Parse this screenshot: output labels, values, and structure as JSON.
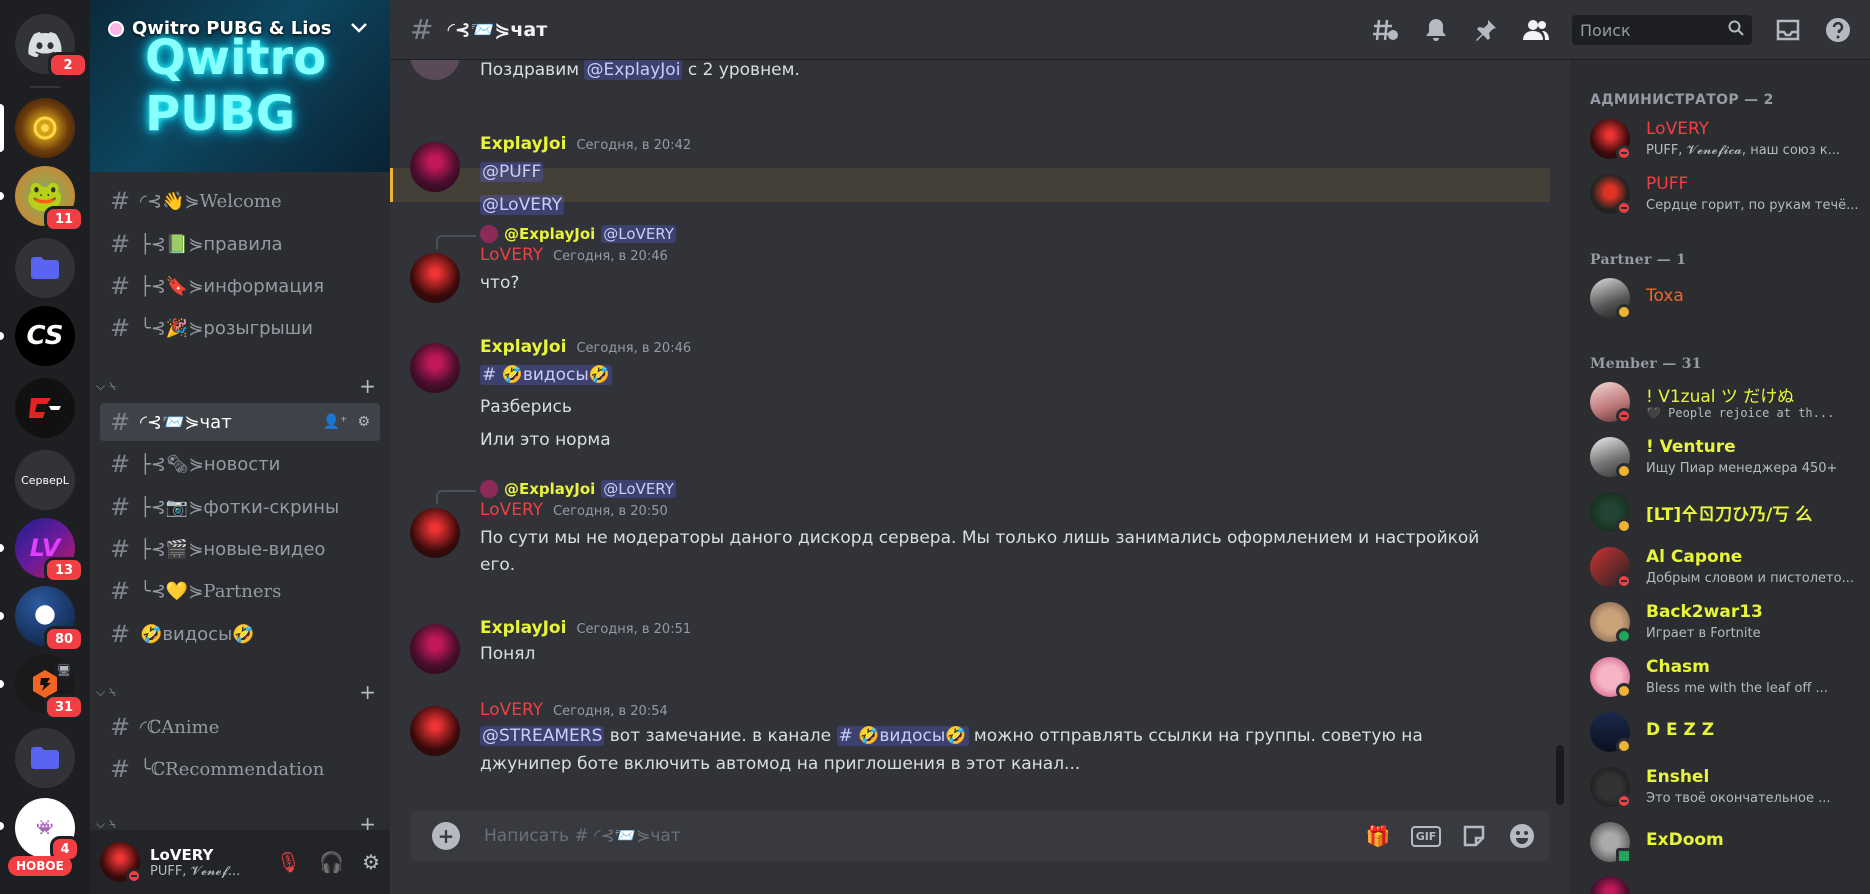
{
  "rail": {
    "badges": [
      "2",
      "11",
      "13",
      "80",
      "31",
      "4"
    ],
    "server_text": "СервepL",
    "new_label": "НОВОЕ"
  },
  "server": {
    "name": "Qwitro PUBG & Lios",
    "banner_text": "Qwitro PUBG"
  },
  "channels": [
    {
      "label": "◜⊰👋⋟Welcome"
    },
    {
      "label": "├⊰📗⋟правила"
    },
    {
      "label": "├⊰🔖⋟информация"
    },
    {
      "label": "╰⊰🎉⋟розыгрыши"
    },
    {
      "label": "◜⊰📨⋟чат"
    },
    {
      "label": "├⊰🗞⋟новости"
    },
    {
      "label": "├⊰📷⋟фотки-скрины"
    },
    {
      "label": "├⊰🎬⋟новые-видео"
    },
    {
      "label": "╰⊰💛⋟Partners"
    },
    {
      "label": "🤣видосы🤣"
    },
    {
      "label": "◜ℂAnime"
    },
    {
      "label": "╰ℂRecommendation"
    }
  ],
  "categories": [
    "⌵ ⍀",
    "⌵ ⍀",
    "⌵ ⍀"
  ],
  "user": {
    "name": "LoVERY",
    "status": "PUFF, 𝓥𝓮𝓷𝓮𝓯..."
  },
  "header": {
    "channel": "◜⊰📨⋟чат",
    "search_placeholder": "Поиск"
  },
  "messages": {
    "m0": {
      "text_a": "Поздравим ",
      "mention": "@ExplayJoi",
      "text_b": " с 2 уровнем."
    },
    "m1": {
      "author": "ExplayJoi",
      "time": "Сегодня, в 20:42",
      "line1": "@PUFF",
      "line2": "@LoVERY"
    },
    "m2": {
      "reply_author": "@ExplayJoi",
      "reply_text": "@LoVERY",
      "author": "LoVERY",
      "time": "Сегодня, в 20:46",
      "text": "что?"
    },
    "m3": {
      "author": "ExplayJoi",
      "time": "Сегодня, в 20:46",
      "channel_mention": "# 🤣видосы🤣",
      "line2": "Разберись",
      "line3": "Или это норма"
    },
    "m4": {
      "reply_author": "@ExplayJoi",
      "reply_text": "@LoVERY",
      "author": "LoVERY",
      "time": "Сегодня, в 20:50",
      "line1": "По сути мы не модераторы даного дискорд сервера. Мы только лишь занимались оформлением и настройкой",
      "line2": "его."
    },
    "m5": {
      "author": "ExplayJoi",
      "time": "Сегодня, в 20:51",
      "text": "Понял"
    },
    "m6": {
      "author": "LoVERY",
      "time": "Сегодня, в 20:54",
      "mention": "@STREAMERS",
      "text_a": " вот замечание. в канале ",
      "channel_mention": "# 🤣видосы🤣",
      "text_b": " можно отправлять ссылки на группы. советую на",
      "line2": "джунипер боте включить автомод на приглошения в этот канал..."
    }
  },
  "composer": {
    "placeholder": "Написать # ◜⊰📨⋟чат",
    "gif_label": "GIF"
  },
  "members": {
    "groups": [
      "АДМИНИСТРАТОР — 2",
      "Partner — 1",
      "Member — 31"
    ],
    "list": [
      {
        "name": "LoVERY",
        "status": "PUFF, 𝓥𝓮𝓷𝓮𝓯𝓲𝓬𝓪, наш союз к...",
        "color": "#f23f43"
      },
      {
        "name": "PUFF",
        "status": "Сердце горит, по рукам течё...",
        "color": "#f23f43"
      },
      {
        "name": "Toxa",
        "status": "",
        "color": "#f26522"
      },
      {
        "name": "! V1zual ツ だけぬ",
        "status": "🖤 People rejoice at th...",
        "color": "#e8f53b"
      },
      {
        "name": "! Venture",
        "status": "Ищу Пиар менеджера 450+",
        "color": "#e8f53b"
      },
      {
        "name": "[LT]㐃ㄖ刀ひ乃/丂 么",
        "status": "",
        "color": "#e8f53b"
      },
      {
        "name": "Al Capone",
        "status": "Добрым словом и пистолето...",
        "color": "#e8f53b"
      },
      {
        "name": "Back2war13",
        "status": "Играет в Fortnite",
        "color": "#e8f53b"
      },
      {
        "name": "Chasm",
        "status": "Bless me with the leaf off ...",
        "color": "#e8f53b"
      },
      {
        "name": "D E Z Z",
        "status": "",
        "color": "#e8f53b"
      },
      {
        "name": "Enshel",
        "status": "Это твоё окончательное ...",
        "color": "#e8f53b"
      },
      {
        "name": "ExDoom",
        "status": "",
        "color": "#e8f53b"
      }
    ]
  },
  "colors": {
    "explay": "#e8f53b",
    "lovery": "#f23f43",
    "accent": "#5865f2"
  }
}
